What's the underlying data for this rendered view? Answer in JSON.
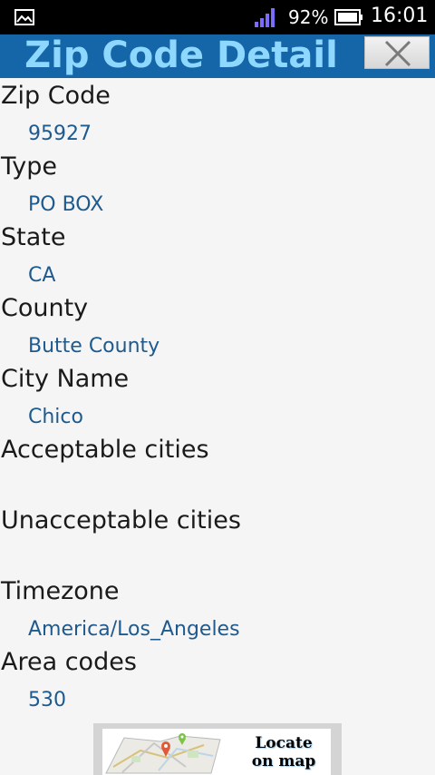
{
  "status_bar": {
    "battery_percent": "92%",
    "time": "16:01",
    "icons": [
      "gallery-icon",
      "signal-icon",
      "battery-icon"
    ]
  },
  "header": {
    "title": "Zip Code Detail",
    "close_icon": "close-icon"
  },
  "fields": [
    {
      "label": "Zip Code",
      "value": "95927"
    },
    {
      "label": "Type",
      "value": "PO BOX"
    },
    {
      "label": "State",
      "value": "CA"
    },
    {
      "label": "County",
      "value": "Butte County"
    },
    {
      "label": "City Name",
      "value": "Chico"
    },
    {
      "label": "Acceptable cities",
      "value": ""
    },
    {
      "label": "Unacceptable cities",
      "value": ""
    },
    {
      "label": "Timezone",
      "value": "America/Los_Angeles"
    },
    {
      "label": "Area codes",
      "value": "530"
    }
  ],
  "map_button": {
    "line1": "Locate",
    "line2": "on map",
    "icon": "map-icon"
  },
  "colors": {
    "header_bg": "#1466a8",
    "title": "#8ed8ff",
    "value_text": "#1f5a8e"
  }
}
